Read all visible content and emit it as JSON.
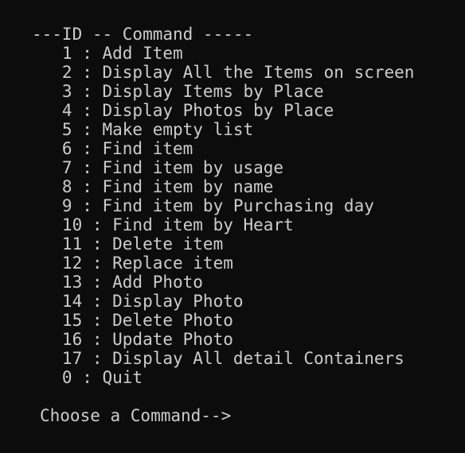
{
  "console": {
    "header": "---ID -- Command -----",
    "menu": [
      {
        "line": "   1 : Add Item"
      },
      {
        "line": "   2 : Display All the Items on screen"
      },
      {
        "line": "   3 : Display Items by Place"
      },
      {
        "line": "   4 : Display Photos by Place"
      },
      {
        "line": "   5 : Make empty list"
      },
      {
        "line": "   6 : Find item"
      },
      {
        "line": "   7 : Find item by usage"
      },
      {
        "line": "   8 : Find item by name"
      },
      {
        "line": "   9 : Find item by Purchasing day"
      },
      {
        "line": "   10 : Find item by Heart"
      },
      {
        "line": "   11 : Delete item"
      },
      {
        "line": "   12 : Replace item"
      },
      {
        "line": "   13 : Add Photo"
      },
      {
        "line": "   14 : Display Photo"
      },
      {
        "line": "   15 : Delete Photo"
      },
      {
        "line": "   16 : Update Photo"
      },
      {
        "line": "   17 : Display All detail Containers"
      },
      {
        "line": "   0 : Quit"
      }
    ],
    "prompt": "Choose a Command-->"
  },
  "colors": {
    "background": "#0c0c0c",
    "text": "#cccccc"
  }
}
